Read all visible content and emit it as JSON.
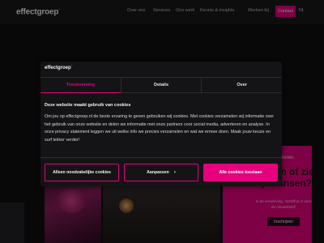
{
  "site": {
    "logo_text": "effectgroep",
    "logo_mark": "+",
    "nav": {
      "items": [
        "Over ons",
        "Services",
        "Ons werk",
        "Kennis & insights",
        "Werken bij"
      ],
      "contact_label": "Contact",
      "lang_label": "NL"
    },
    "promo": {
      "eyebrow": "deren.",
      "title": "...ken of zie je kansen?",
      "body": "In de verwerving, 'Schriff je in voor de nieuwsbrief'",
      "button_label": "Inschrijven"
    }
  },
  "cookie_modal": {
    "logo_text": "effectgroep",
    "logo_mark": "+",
    "tabs": [
      {
        "label": "Toestemming",
        "active": true
      },
      {
        "label": "Details",
        "active": false
      },
      {
        "label": "Over",
        "active": false
      }
    ],
    "heading": "Deze website maakt gebruik van cookies",
    "body": "Om jou op effectgroep.nl de beste ervaring te geven gebruiken wij cookies. Met cookies verzamelen wij informatie over het gebruik van onze website en delen we informatie met onze partners voor social media, adverteren en analyse. In onze privacy statement leggen we uit welke info we precies verzamelen en wat we ermee doen. Maak jouw keuze en surf lekker verder!",
    "buttons": {
      "necessary": "Alleen noodzakelijke cookies",
      "customize": "Aanpassen",
      "customize_icon": "chevron-right-icon",
      "accept_all": "Alle cookies toestaan"
    }
  },
  "colors": {
    "accent": "#e6007e",
    "modal_bg": "#141416",
    "page_bg": "#111113"
  }
}
